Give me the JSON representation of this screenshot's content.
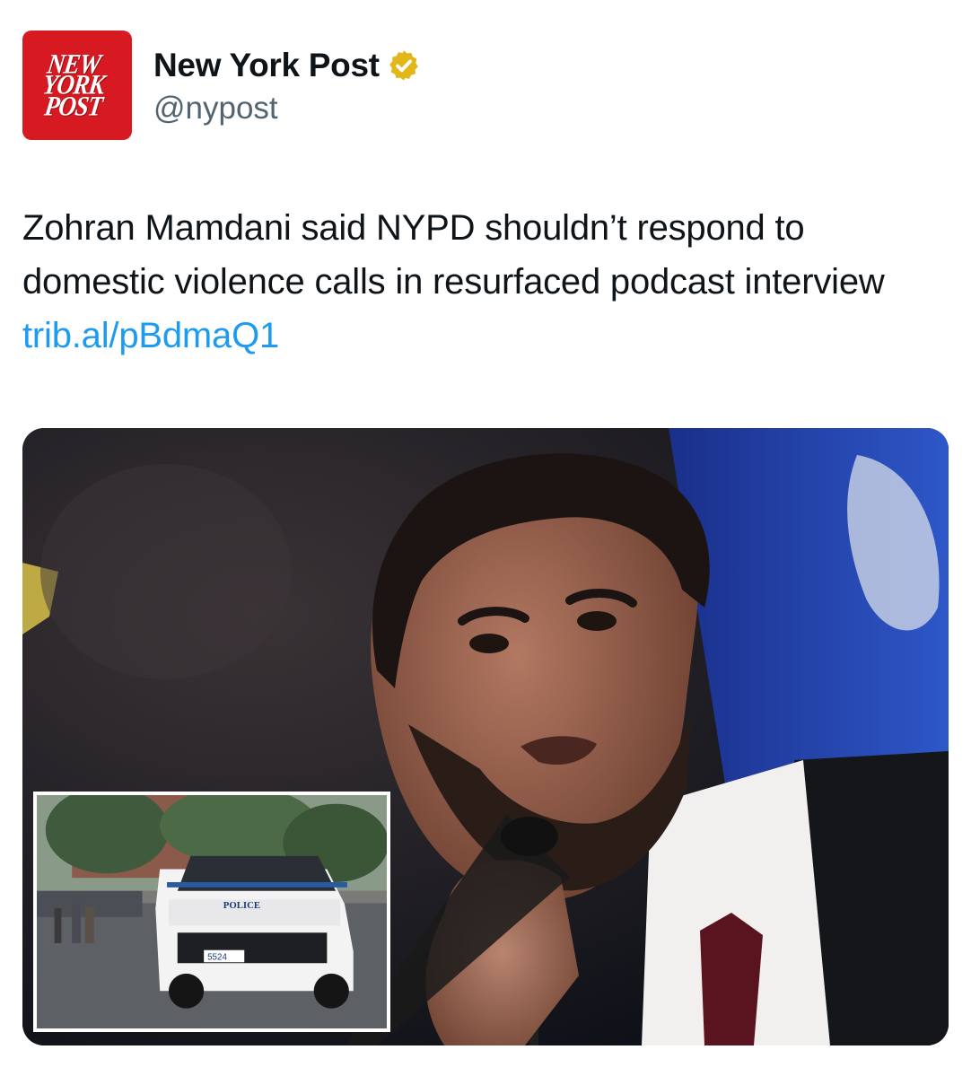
{
  "account": {
    "logo_lines": [
      "NEW",
      "YORK",
      "POST"
    ],
    "display_name": "New York Post",
    "handle": "@nypost",
    "verified_color": "#e2b719"
  },
  "tweet": {
    "text": "Zohran Mamdani said NYPD shouldn’t respond to domestic violence calls in resurfaced podcast interview ",
    "link": "trib.al/pBdmaQ1"
  },
  "media": {
    "inset_vehicle_label": "POLICE",
    "inset_vehicle_number": "5524"
  },
  "colors": {
    "brand_red": "#d71a21",
    "link_blue": "#1d9bf0",
    "handle_gray": "#536471"
  }
}
